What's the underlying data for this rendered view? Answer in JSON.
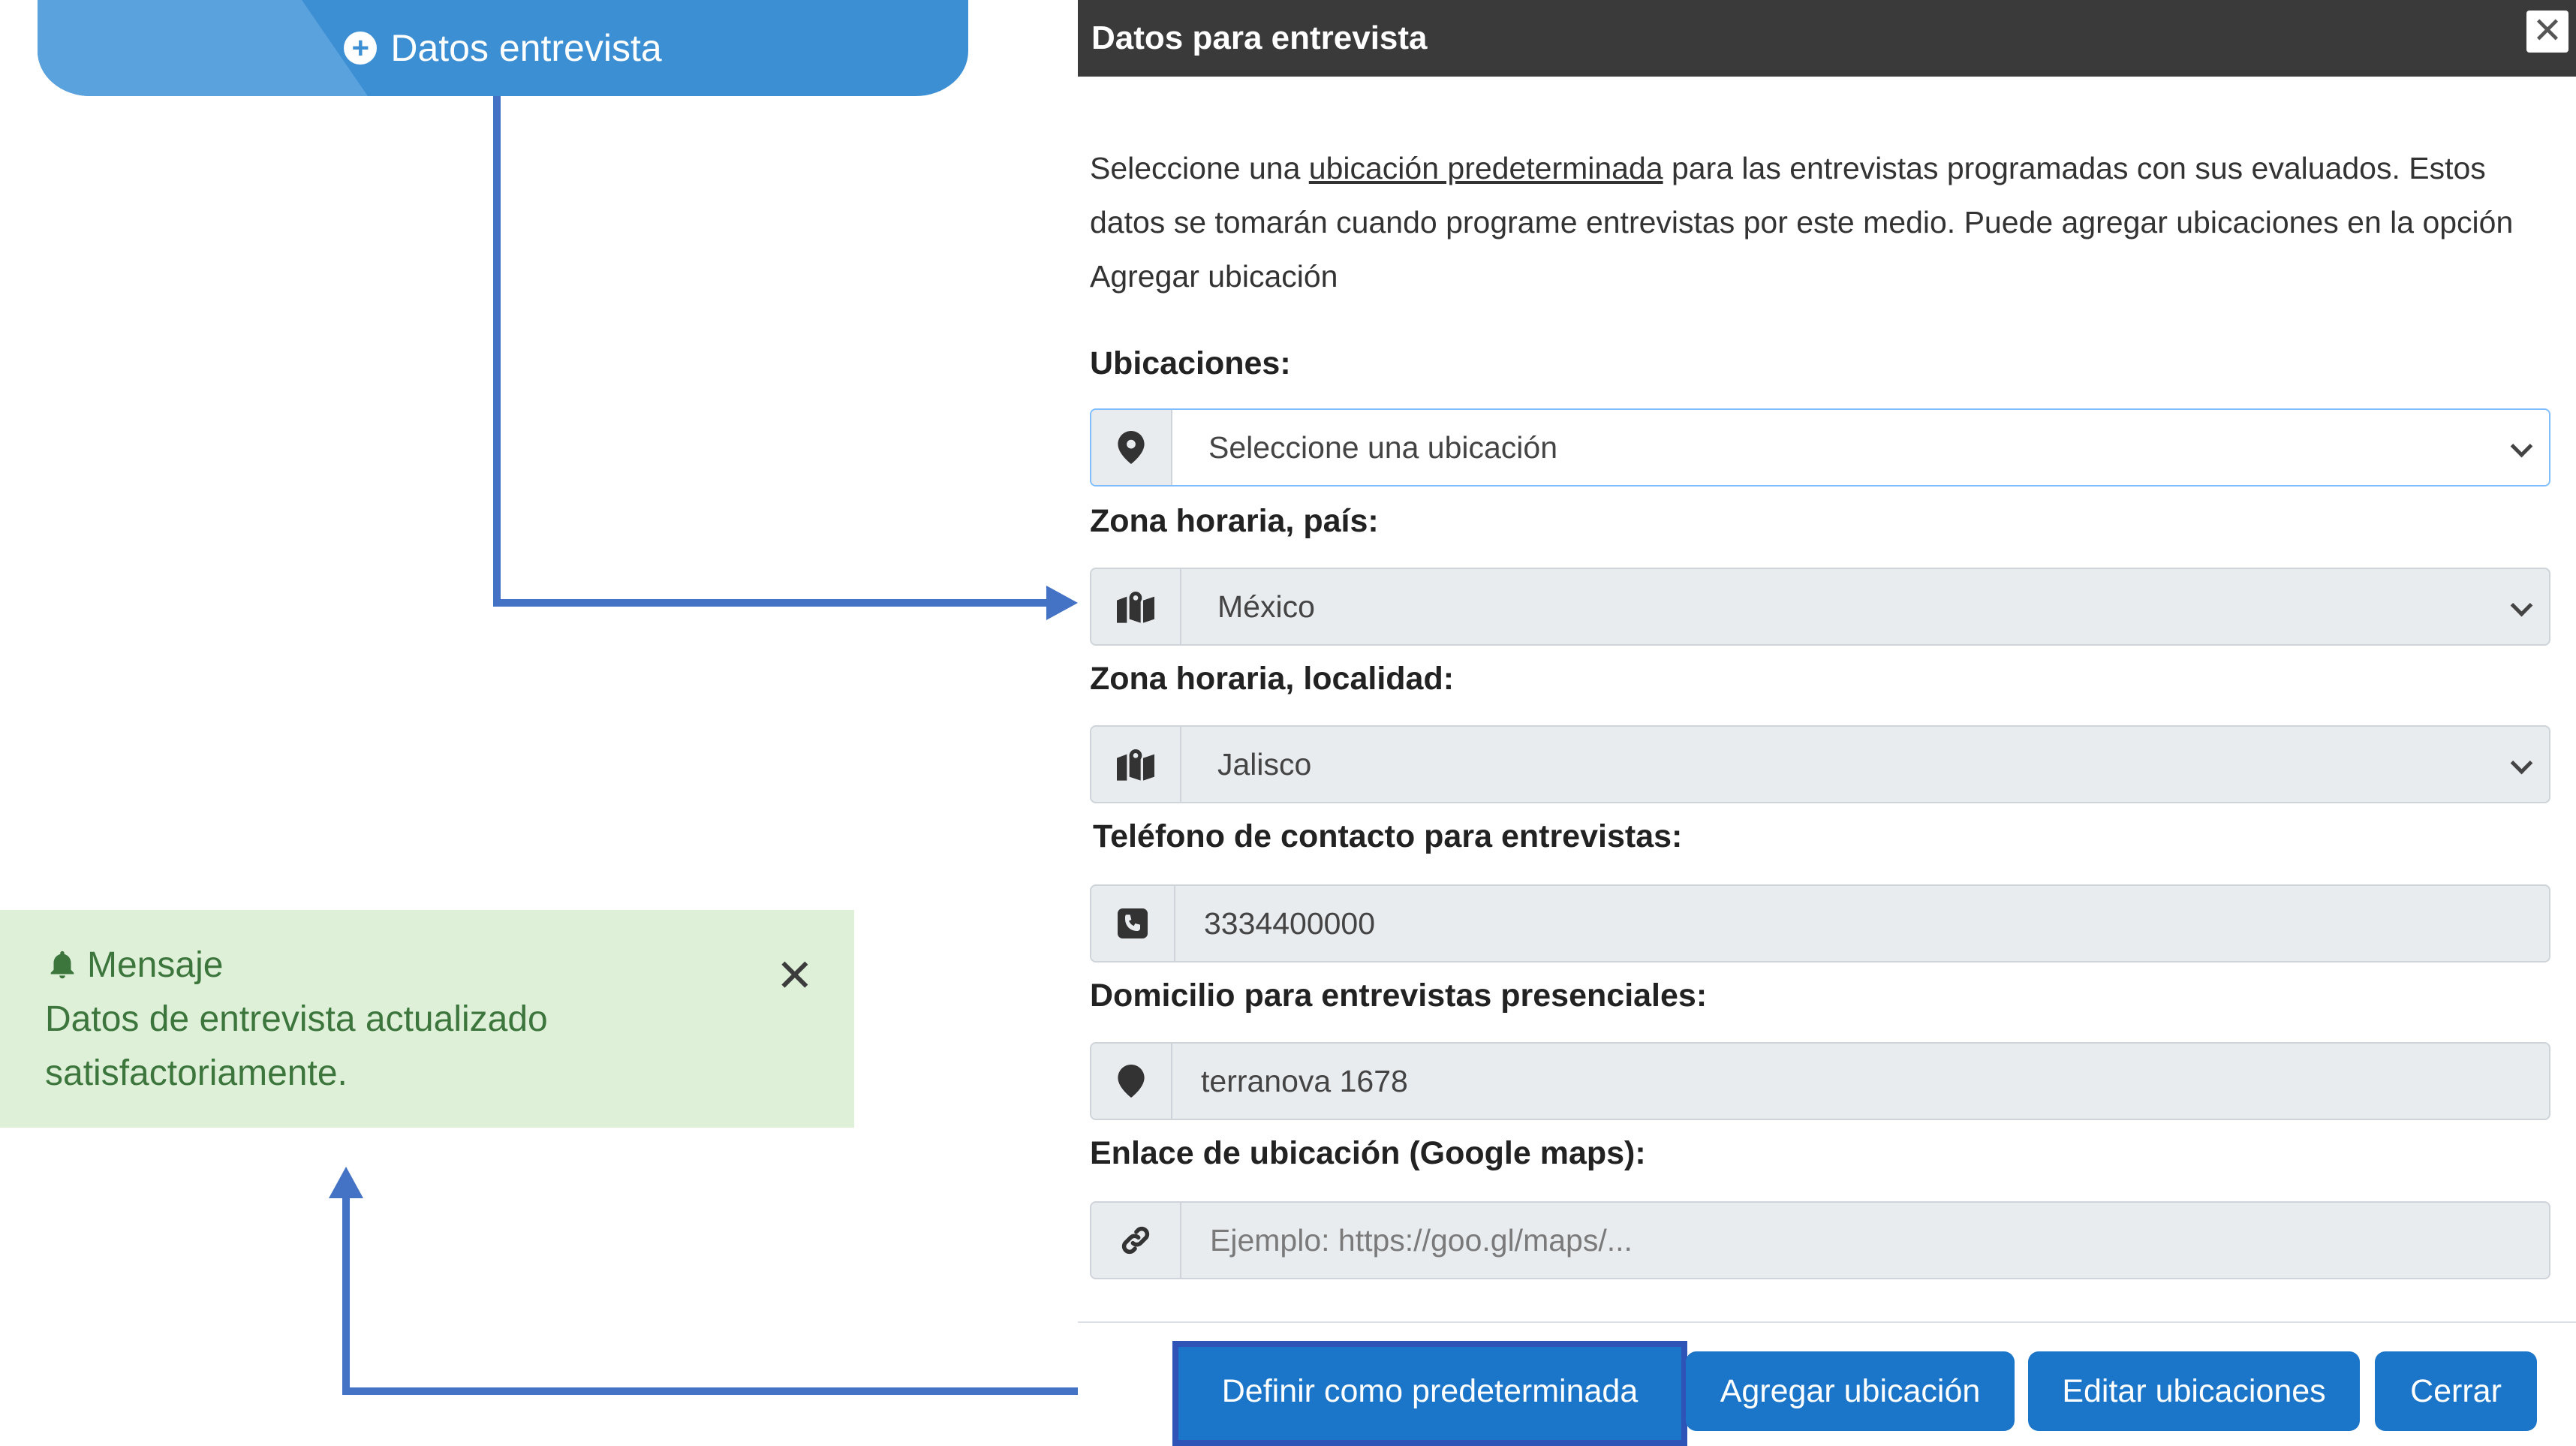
{
  "pill_button": {
    "label": "Datos entrevista"
  },
  "toast": {
    "title": "Mensaje",
    "message_line1": "Datos de entrevista actualizado",
    "message_line2": "satisfactoriamente.",
    "close_glyph": "✕"
  },
  "modal": {
    "title": "Datos para entrevista",
    "close_glyph": "✕",
    "description": {
      "part1": "Seleccione una ",
      "link": "ubicación predeterminada",
      "part2": " para las entrevistas programadas con sus evaluados. Estos datos se tomarán cuando programe entrevistas por este medio. Puede agregar ubicaciones en la opción Agregar ubicación"
    },
    "fields": {
      "ubicaciones": {
        "label": "Ubicaciones:",
        "value": "Seleccione una ubicación",
        "icon": "map-marker-icon"
      },
      "zona_pais": {
        "label": "Zona horaria, país:",
        "value": "México",
        "icon": "map-icon"
      },
      "zona_localidad": {
        "label": "Zona horaria, localidad:",
        "value": "Jalisco",
        "icon": "map-icon"
      },
      "telefono": {
        "label": "Teléfono de contacto para entrevistas:",
        "value": "3334400000",
        "icon": "phone-square-icon"
      },
      "domicilio": {
        "label": "Domicilio para entrevistas presenciales:",
        "value": "terranova 1678",
        "icon": "map-marker-icon"
      },
      "enlace": {
        "label": "Enlace de ubicación (Google maps):",
        "placeholder": "Ejemplo: https://goo.gl/maps/...",
        "icon": "link-icon"
      }
    },
    "buttons": {
      "definir": "Definir como predeterminada",
      "agregar": "Agregar ubicación",
      "editar": "Editar ubicaciones",
      "cerrar": "Cerrar"
    }
  },
  "colors": {
    "primary_button": "#1b75c9",
    "pill": "#3d8fd3",
    "connector": "#4472c4",
    "toast_bg": "#dff0d8",
    "toast_text": "#3c763d",
    "modal_header": "#3a3a3a"
  }
}
